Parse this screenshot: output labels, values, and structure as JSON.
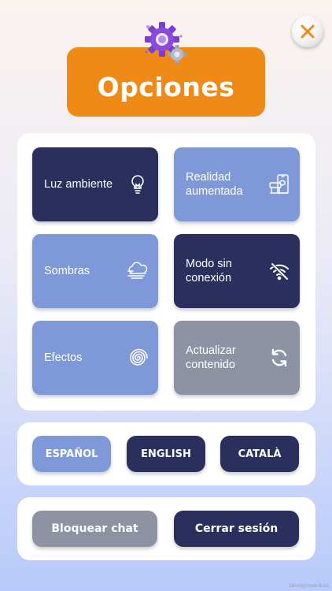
{
  "title": "Opciones",
  "options": [
    {
      "label": "Luz ambiente",
      "icon": "lightbulb-icon"
    },
    {
      "label": "Realidad aumentada",
      "icon": "augmented-reality-icon"
    },
    {
      "label": "Sombras",
      "icon": "cloud-shadow-icon"
    },
    {
      "label": "Modo sin conexión",
      "icon": "wifi-off-icon"
    },
    {
      "label": "Efectos",
      "icon": "spiral-icon"
    },
    {
      "label": "Actualizar contenido",
      "icon": "refresh-icon"
    }
  ],
  "languages": [
    {
      "label": "ESPAÑOL",
      "selected": true
    },
    {
      "label": "ENGLISH",
      "selected": false
    },
    {
      "label": "CATALÀ",
      "selected": false
    }
  ],
  "actions": {
    "block_chat": "Bloquear chat",
    "logout": "Cerrar sesión"
  },
  "watermark": "Development Build",
  "colors": {
    "accent_orange": "#ef8a17",
    "tile_dark": "#2b2f5e",
    "tile_light": "#7f99d8",
    "tile_gray": "#8e93a3",
    "close_x": "#ef8a17"
  }
}
